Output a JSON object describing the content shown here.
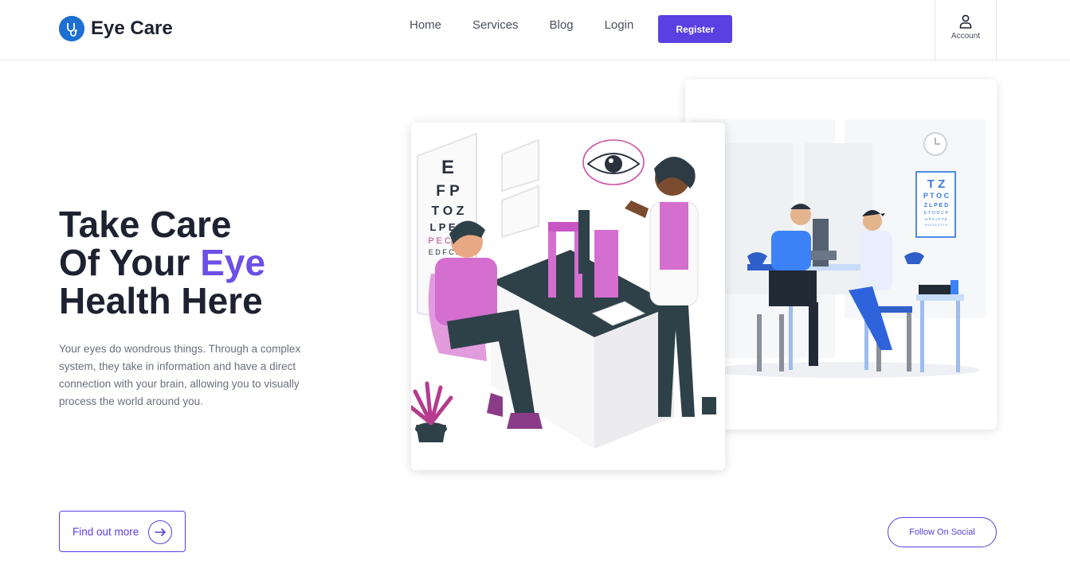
{
  "brand": {
    "name": "Eye Care",
    "icon": "stethoscope-icon",
    "icon_color": "#1d6fd1"
  },
  "nav": {
    "items": [
      "Home",
      "Services",
      "Blog",
      "Login"
    ]
  },
  "header": {
    "register_label": "Register",
    "account_label": "Account",
    "account_icon": "user-icon"
  },
  "hero": {
    "title_line1": "Take Care",
    "title_line2_prefix": "Of Your ",
    "title_line2_accent": "Eye",
    "title_line3": "Health Here",
    "description": "Your eyes do wondrous things. Through a complex system, they take in information and have a direct connection with your brain, allowing you to visually process the world around you.",
    "find_out_more_label": "Find out more",
    "follow_label": "Follow On Social"
  },
  "illustrations": {
    "front_chart_letters": [
      "E",
      "F P",
      "T O Z",
      "L P E D",
      "P E C F D",
      "E D F C Z P"
    ],
    "back_chart_letters": [
      "T Z",
      "P T O C",
      "Z L P E D",
      "E T O D C P",
      "D P C L F T E",
      "P E Z O L C F T D"
    ]
  },
  "colors": {
    "accent": "#5a3fe3",
    "accent_text": "#6c4fe6",
    "dark_text": "#1e2230",
    "muted_text": "#6a6f7c"
  }
}
